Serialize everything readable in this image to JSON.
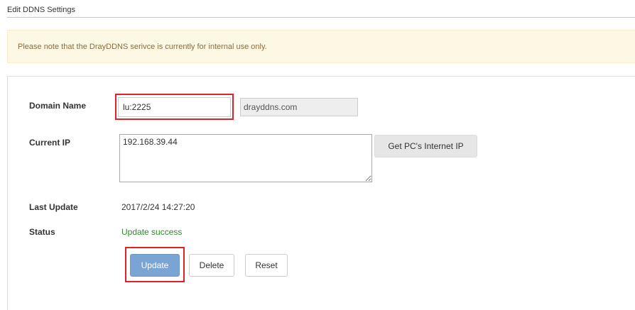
{
  "page": {
    "title": "Edit DDNS Settings"
  },
  "notice": {
    "text": "Please note that the DrayDDNS serivce is currently for internal use only."
  },
  "form": {
    "domain_name": {
      "label": "Domain Name",
      "value": "lu:2225",
      "suffix": "drayddns.com"
    },
    "current_ip": {
      "label": "Current IP",
      "value": "192.168.39.44",
      "button_label": "Get PC's Internet IP"
    },
    "last_update": {
      "label": "Last Update",
      "value": "2017/2/24 14:27:20"
    },
    "status": {
      "label": "Status",
      "value": "Update success"
    }
  },
  "actions": {
    "update_label": "Update",
    "delete_label": "Delete",
    "reset_label": "Reset"
  },
  "colors": {
    "highlight": "#e0202a",
    "status_success": "#2e8b2e",
    "primary_button": "#7aa4d4",
    "notice_background": "#fcf8e3"
  }
}
